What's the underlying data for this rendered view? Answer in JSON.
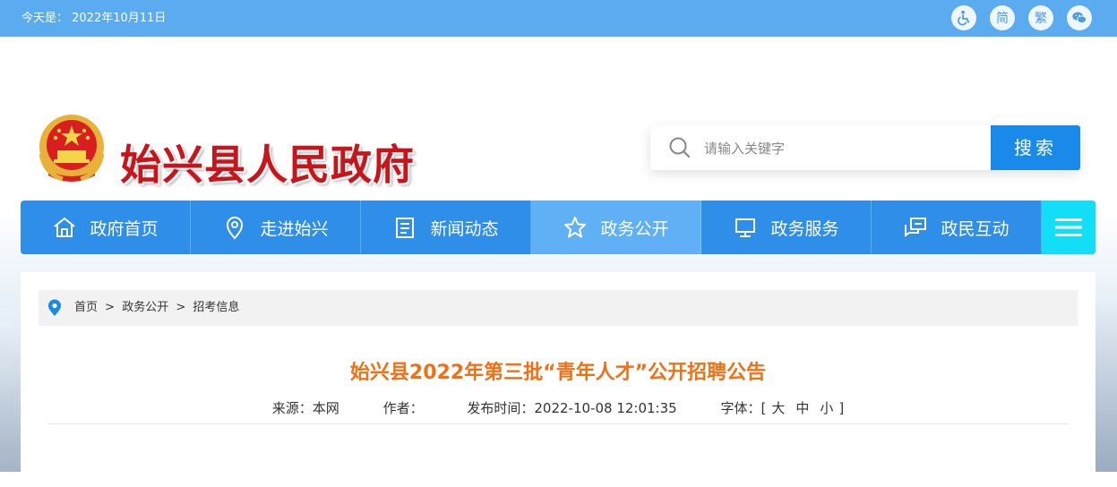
{
  "topbar": {
    "date_text": "今天是： 2022年10月11日",
    "tools": [
      {
        "icon": "accessibility-icon",
        "label": ""
      },
      {
        "icon": "",
        "label": "简"
      },
      {
        "icon": "",
        "label": "繁"
      },
      {
        "icon": "wechat-icon",
        "label": ""
      }
    ]
  },
  "header": {
    "site_title": "始兴县人民政府",
    "emblem": "national-emblem"
  },
  "search": {
    "placeholder": "请输入关键字",
    "button_label": "搜索"
  },
  "nav": {
    "items": [
      {
        "label": "政府首页",
        "icon": "home-icon"
      },
      {
        "label": "走进始兴",
        "icon": "location-icon"
      },
      {
        "label": "新闻动态",
        "icon": "news-icon"
      },
      {
        "label": "政务公开",
        "icon": "star-icon",
        "active": true
      },
      {
        "label": "政务服务",
        "icon": "monitor-icon"
      },
      {
        "label": "政民互动",
        "icon": "chat-icon"
      }
    ],
    "menu_icon": "hamburger-icon"
  },
  "breadcrumb": {
    "items": [
      "首页",
      "政务公开",
      "招考信息"
    ],
    "separator": ">"
  },
  "article": {
    "title": "始兴县2022年第三批“青年人才”公开招聘公告",
    "source_label": "来源：",
    "source_value": "本网",
    "author_label": "作者：",
    "author_value": "",
    "time_label": "发布时间：",
    "time_value": "2022-10-08 12:01:35",
    "font_label": "字体：",
    "font_open": "[",
    "font_large": "大",
    "font_medium": "中",
    "font_small": "小",
    "font_close": "]"
  },
  "colors": {
    "topbar": "#5aabf0",
    "nav": "#2e8ee8",
    "nav_active": "#5fb0f4",
    "nav_menu": "#12dff5",
    "title_red": "#c8141b",
    "article_title": "#f07016",
    "search_button": "#1a8aea"
  }
}
